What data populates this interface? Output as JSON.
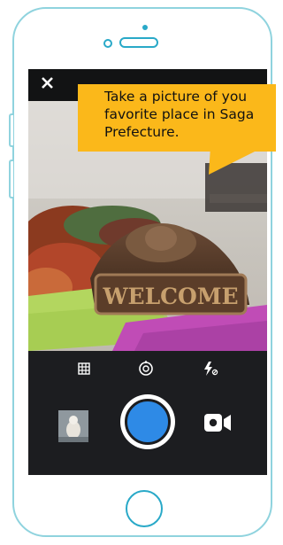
{
  "camera": {
    "instruction_lines": [
      "Take a picture of you",
      "favorite place in Saga",
      "Prefecture."
    ],
    "scene_sign_text": "WELCOME"
  },
  "icons": {
    "close": "close-icon",
    "grid": "grid-icon",
    "timer": "timer-icon",
    "flash": "flash-off-icon",
    "gallery": "gallery-thumbnail",
    "shutter": "shutter-button",
    "video": "video-camera-icon"
  },
  "colors": {
    "phone_outline": "#8fd3de",
    "accent": "#29a9c8",
    "callout": "#fbb81a",
    "shutter": "#2e8ae6",
    "screen_bg": "#1c1d20"
  }
}
